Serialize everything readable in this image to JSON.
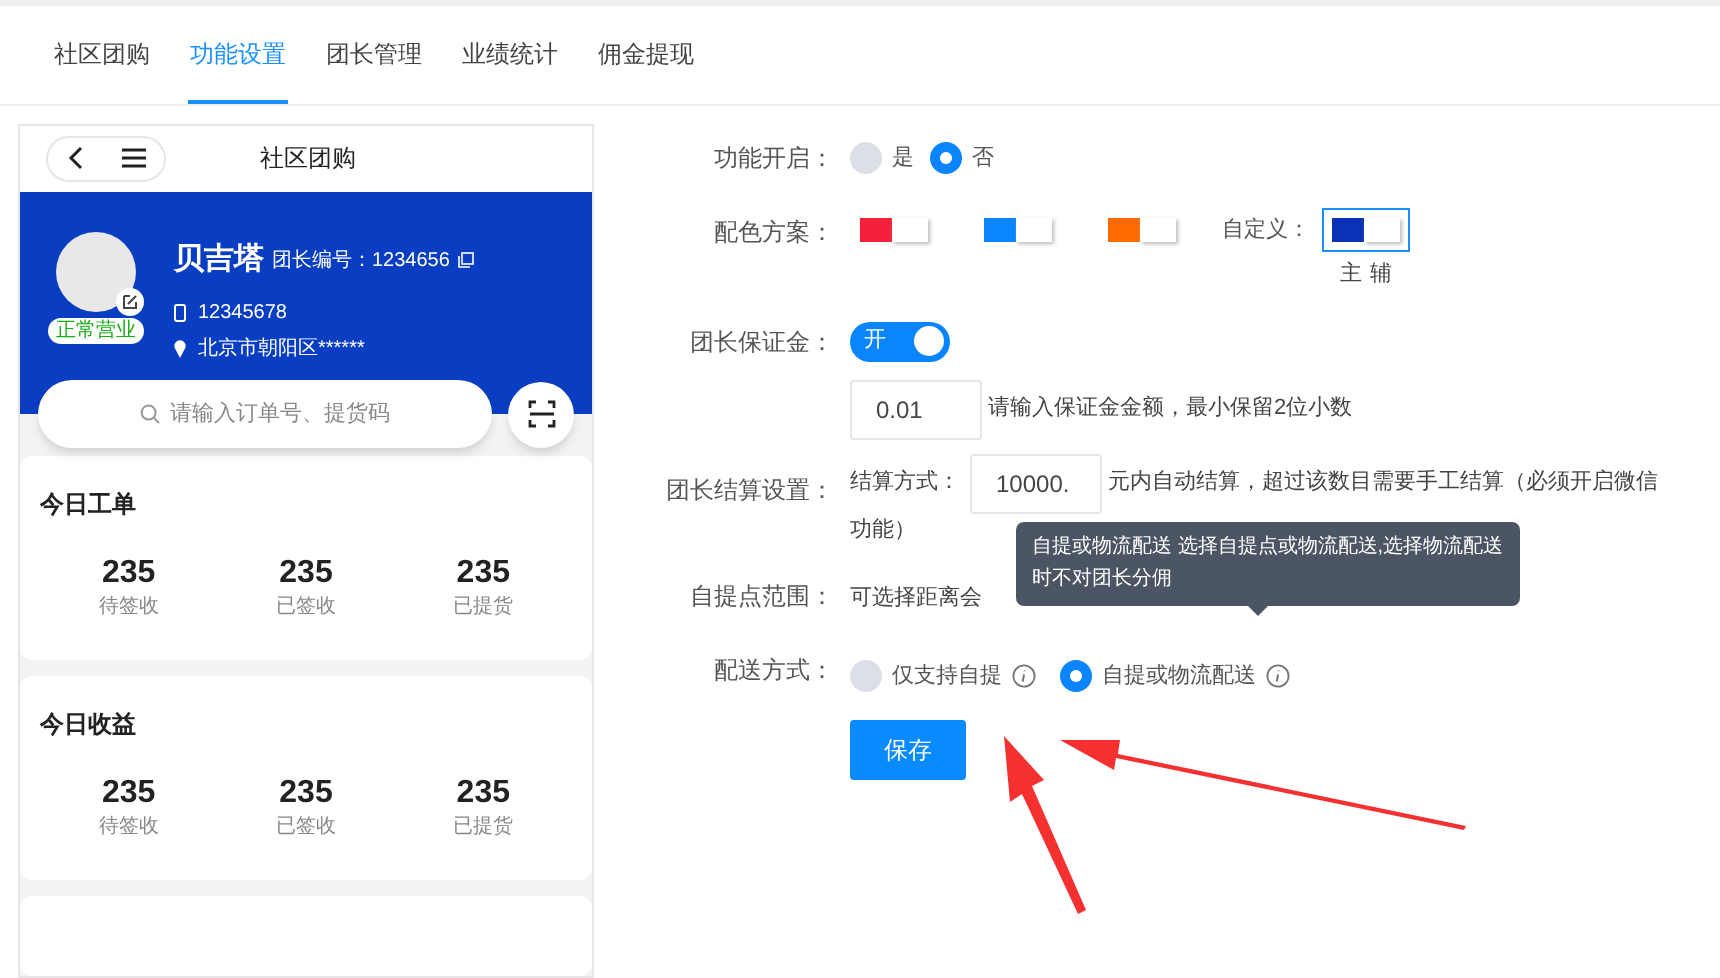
{
  "tabs": [
    {
      "label": "社区团购",
      "selected": false
    },
    {
      "label": "功能设置",
      "selected": true
    },
    {
      "label": "团长管理",
      "selected": false
    },
    {
      "label": "业绩统计",
      "selected": false
    },
    {
      "label": "佣金提现",
      "selected": false
    }
  ],
  "preview": {
    "title": "社区团购",
    "profile": {
      "name": "贝吉塔",
      "id_label": "团长编号：1234656",
      "status": "正常营业",
      "phone": "12345678",
      "address": "北京市朝阳区******"
    },
    "search": {
      "placeholder": "请输入订单号、提货码"
    },
    "cards": [
      {
        "title": "今日工单",
        "stats": [
          {
            "value": "235",
            "label": "待签收"
          },
          {
            "value": "235",
            "label": "已签收"
          },
          {
            "value": "235",
            "label": "已提货"
          }
        ]
      },
      {
        "title": "今日收益",
        "stats": [
          {
            "value": "235",
            "label": "待签收"
          },
          {
            "value": "235",
            "label": "已签收"
          },
          {
            "value": "235",
            "label": "已提货"
          }
        ]
      }
    ]
  },
  "form": {
    "enable": {
      "label": "功能开启：",
      "options": [
        {
          "label": "是",
          "selected": false
        },
        {
          "label": "否",
          "selected": true
        }
      ]
    },
    "scheme": {
      "label": "配色方案：",
      "custom_label": "自定义：",
      "main_label": "主",
      "sub_label": "辅",
      "swatches": [
        {
          "color": "#f5213a",
          "selected": false
        },
        {
          "color": "#0a84ff",
          "selected": false
        },
        {
          "color": "#ff6a00",
          "selected": false
        },
        {
          "color": "#0a32b8",
          "selected": true,
          "kind": "custom"
        }
      ]
    },
    "deposit": {
      "label": "团长保证金：",
      "on": true,
      "on_label": "开",
      "value": "0.01",
      "hint": "请输入保证金金额，最小保留2位小数"
    },
    "settlement": {
      "label": "团长结算设置：",
      "prefix": "结算方式：",
      "value": "10000.",
      "line1": "元内自动结算，超过该数目需要手工结算（必须开启微信",
      "line2": "功能）"
    },
    "range": {
      "label": "自提点范围：",
      "text": "可选择距离会"
    },
    "delivery": {
      "label": "配送方式：",
      "options": [
        {
          "label": "仅支持自提",
          "selected": false
        },
        {
          "label": "自提或物流配送",
          "selected": true
        }
      ]
    },
    "tooltip": "自提或物流配送 选择自提点或物流配送,选择物流配送时不对团长分佣",
    "save": "保存"
  }
}
